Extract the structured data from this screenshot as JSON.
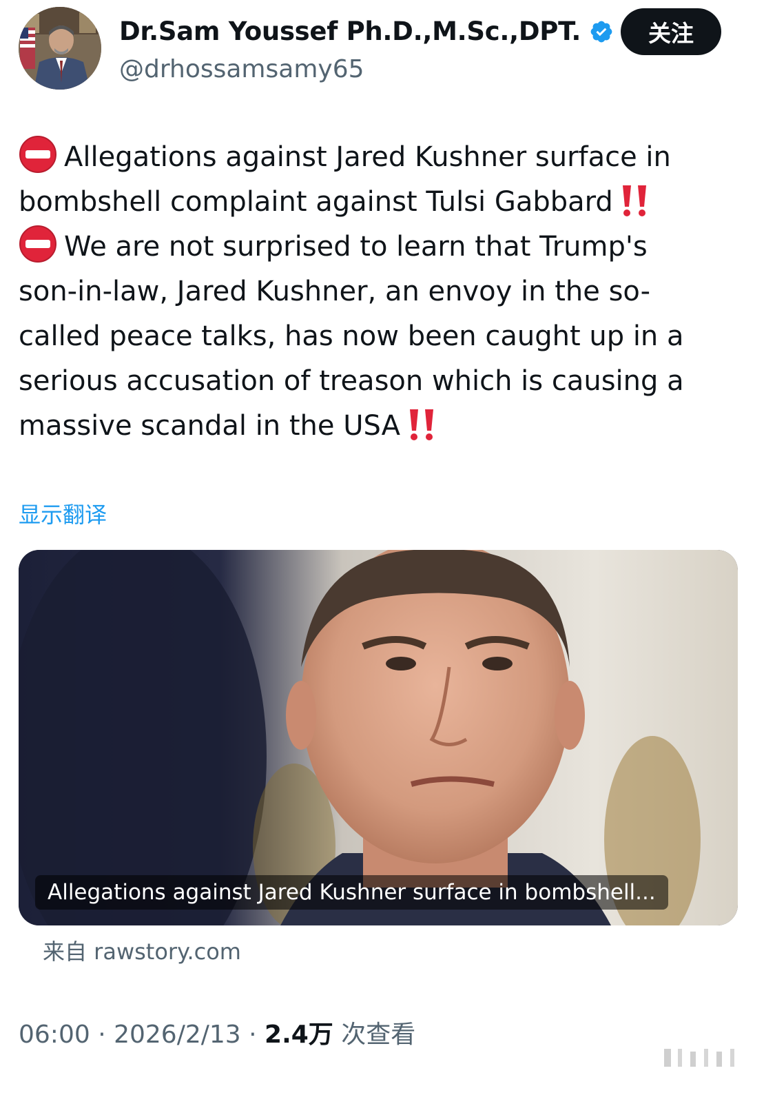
{
  "author": {
    "display_name": "Dr.Sam Youssef Ph.D.,M.Sc.,DPT.",
    "handle": "@drhossamsamy65",
    "verified": true
  },
  "follow_label": "关注",
  "tweet": {
    "lines": [
      "Allegations against Jared Kushner surface in",
      "bombshell complaint against Tulsi Gabbard",
      "We are not surprised to learn that Trump's",
      "son-in-law, Jared Kushner, an envoy in the so-",
      "called peace talks, has now been caught up in a",
      "serious accusation of treason which is causing a",
      "massive scandal in the USA"
    ]
  },
  "translate_label": "显示翻译",
  "card": {
    "caption": "Allegations against Jared Kushner surface in bombshell...",
    "source": "来自 rawstory.com"
  },
  "meta": {
    "time": "06:00",
    "separator": " · ",
    "date": "2026/2/13",
    "views_count": "2.4万",
    "views_label": "次查看"
  },
  "colors": {
    "accent": "#1d9bf0",
    "text": "#0f1419",
    "secondary": "#536471",
    "alert": "#e0243a"
  },
  "icons": {
    "verified": "verified-badge-icon",
    "no_entry": "no-entry-icon",
    "double_exclamation": "double-exclamation-icon"
  }
}
